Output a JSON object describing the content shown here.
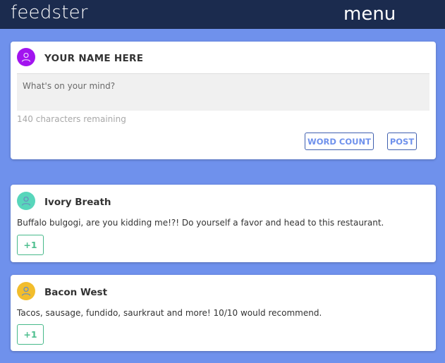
{
  "header": {
    "brand": "feedster",
    "menu_label": "menu"
  },
  "composer": {
    "username": "YOUR NAME HERE",
    "avatar_color": "#a214ef",
    "placeholder": "What's on your mind?",
    "value": "",
    "remaining_text": "140 characters remaining",
    "word_count_label": "WORD COUNT",
    "post_label": "POST"
  },
  "posts": [
    {
      "author": "Ivory Breath",
      "avatar_color": "#58d6bb",
      "text": "Buffalo bulgogi, are you kidding me!?! Do yourself a favor and head to this restaurant.",
      "plus_label": "+1"
    },
    {
      "author": "Bacon West",
      "avatar_color": "#f2bd2c",
      "text": "Tacos, sausage, fundido, saurkraut and more! 10/10 would recommend.",
      "plus_label": "+1"
    }
  ],
  "colors": {
    "page_background": "#6f91ec",
    "header_background": "#1b2b4e",
    "accent": "#6f91ec",
    "plus_one": "#4fbf8f"
  },
  "icons": {
    "avatar": "person-icon"
  }
}
